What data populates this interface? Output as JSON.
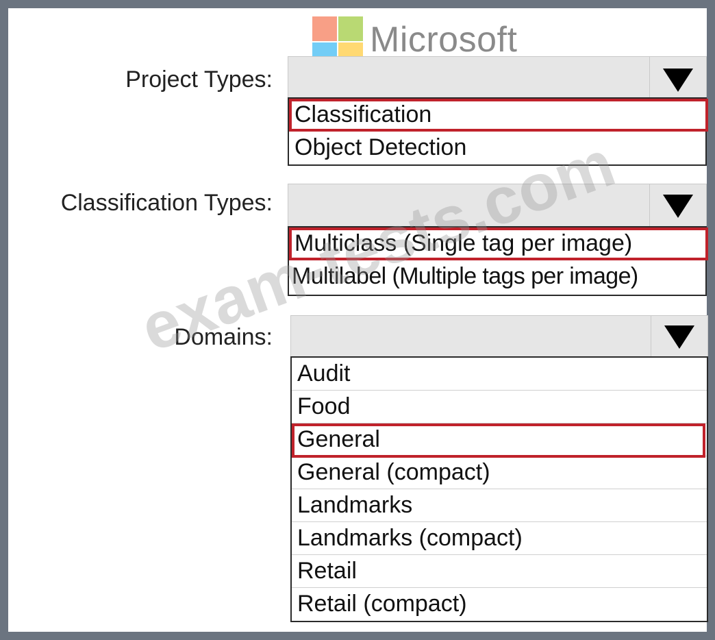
{
  "logo": {
    "name": "Microsoft",
    "colors": {
      "red": "#f25022",
      "green": "#7fba00",
      "blue": "#00a4ef",
      "yellow": "#ffb900"
    }
  },
  "project_types": {
    "label": "Project Types:",
    "selected": "",
    "options": [
      "Classification",
      "Object Detection"
    ],
    "highlighted": "Classification"
  },
  "classification_types": {
    "label": "Classification Types:",
    "selected": "",
    "options": [
      "Multiclass (Single tag per image)",
      "Multilabel (Multiple tags per image)"
    ],
    "highlighted": "Multiclass (Single tag per image)"
  },
  "domains": {
    "label": "Domains:",
    "selected": "",
    "options": [
      "Audit",
      "Food",
      "General",
      "General (compact)",
      "Landmarks",
      "Landmarks (compact)",
      "Retail",
      "Retail (compact)"
    ],
    "highlighted": "General"
  },
  "watermark": "exam-tests.com",
  "highlight_color": "#c0222b"
}
